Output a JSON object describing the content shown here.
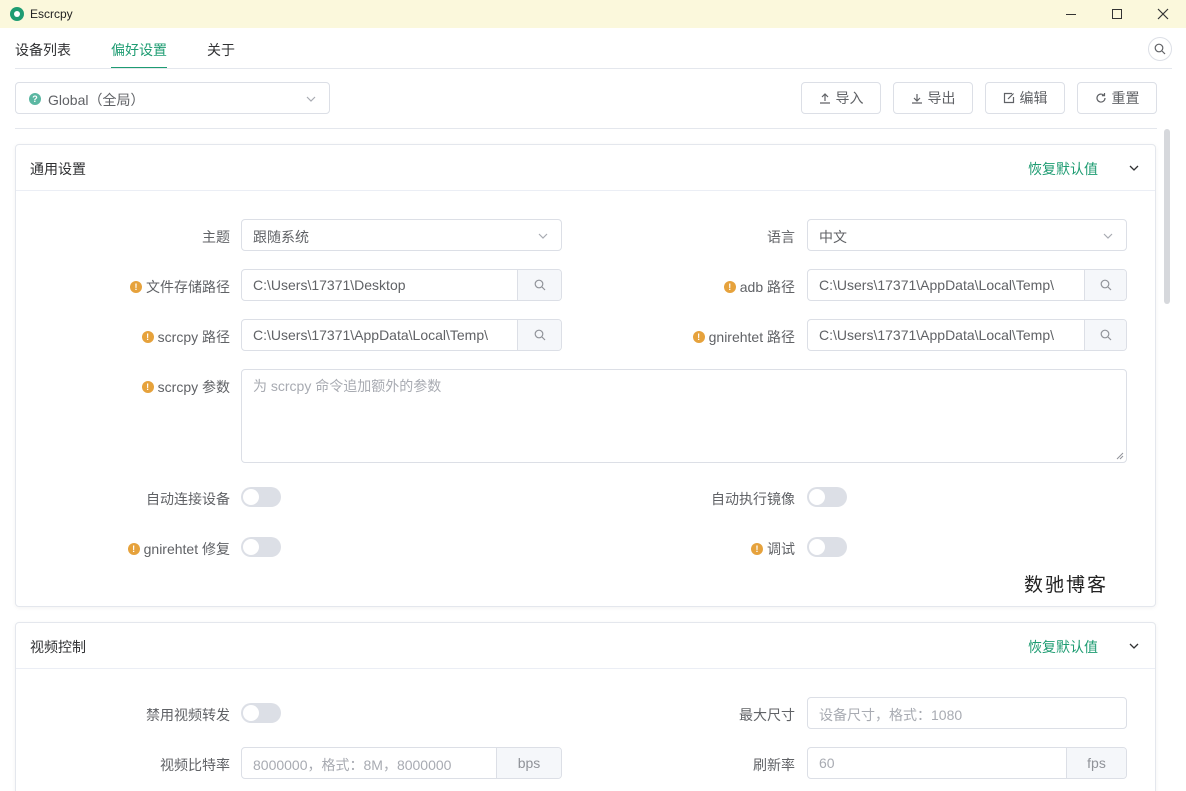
{
  "window": {
    "title": "Escrcpy"
  },
  "tabs": [
    {
      "label": "设备列表",
      "active": false
    },
    {
      "label": "偏好设置",
      "active": true
    },
    {
      "label": "关于",
      "active": false
    }
  ],
  "scope": {
    "value": "Global（全局）"
  },
  "toolbar": {
    "import_label": "导入",
    "export_label": "导出",
    "edit_label": "编辑",
    "reset_label": "重置"
  },
  "general": {
    "title": "通用设置",
    "restore_label": "恢复默认值",
    "theme": {
      "label": "主题",
      "value": "跟随系统"
    },
    "language": {
      "label": "语言",
      "value": "中文"
    },
    "save_path": {
      "label": "文件存储路径",
      "value": "C:\\Users\\17371\\Desktop"
    },
    "adb_path": {
      "label": "adb 路径",
      "value": "C:\\Users\\17371\\AppData\\Local\\Temp\\"
    },
    "scrcpy_path": {
      "label": "scrcpy 路径",
      "value": "C:\\Users\\17371\\AppData\\Local\\Temp\\"
    },
    "gnirehtet_path": {
      "label": "gnirehtet 路径",
      "value": "C:\\Users\\17371\\AppData\\Local\\Temp\\"
    },
    "scrcpy_args": {
      "label": "scrcpy 参数",
      "placeholder": "为 scrcpy 命令追加额外的参数"
    },
    "auto_connect": {
      "label": "自动连接设备",
      "on": false
    },
    "auto_mirror": {
      "label": "自动执行镜像",
      "on": false
    },
    "gnirehtet_fix": {
      "label": "gnirehtet 修复",
      "on": false
    },
    "debug": {
      "label": "调试",
      "on": false
    }
  },
  "watermark": "数驰博客",
  "video": {
    "title": "视频控制",
    "restore_label": "恢复默认值",
    "disable_video": {
      "label": "禁用视频转发",
      "on": false
    },
    "max_size": {
      "label": "最大尺寸",
      "placeholder": "设备尺寸，格式：1080"
    },
    "bitrate": {
      "label": "视频比特率",
      "placeholder": "8000000，格式：8M，8000000",
      "unit": "bps"
    },
    "fps": {
      "label": "刷新率",
      "placeholder": "60",
      "unit": "fps"
    }
  },
  "colors": {
    "accent": "#1e9c72",
    "warning": "#e6a23c",
    "titlebar": "#fbf8dc"
  }
}
